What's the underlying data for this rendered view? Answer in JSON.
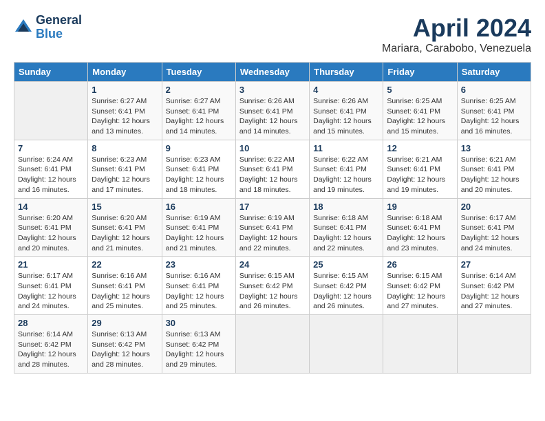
{
  "header": {
    "logo_line1": "General",
    "logo_line2": "Blue",
    "month": "April 2024",
    "location": "Mariara, Carabobo, Venezuela"
  },
  "days_of_week": [
    "Sunday",
    "Monday",
    "Tuesday",
    "Wednesday",
    "Thursday",
    "Friday",
    "Saturday"
  ],
  "weeks": [
    [
      {
        "day": "",
        "sunrise": "",
        "sunset": "",
        "daylight": ""
      },
      {
        "day": "1",
        "sunrise": "Sunrise: 6:27 AM",
        "sunset": "Sunset: 6:41 PM",
        "daylight": "Daylight: 12 hours and 13 minutes."
      },
      {
        "day": "2",
        "sunrise": "Sunrise: 6:27 AM",
        "sunset": "Sunset: 6:41 PM",
        "daylight": "Daylight: 12 hours and 14 minutes."
      },
      {
        "day": "3",
        "sunrise": "Sunrise: 6:26 AM",
        "sunset": "Sunset: 6:41 PM",
        "daylight": "Daylight: 12 hours and 14 minutes."
      },
      {
        "day": "4",
        "sunrise": "Sunrise: 6:26 AM",
        "sunset": "Sunset: 6:41 PM",
        "daylight": "Daylight: 12 hours and 15 minutes."
      },
      {
        "day": "5",
        "sunrise": "Sunrise: 6:25 AM",
        "sunset": "Sunset: 6:41 PM",
        "daylight": "Daylight: 12 hours and 15 minutes."
      },
      {
        "day": "6",
        "sunrise": "Sunrise: 6:25 AM",
        "sunset": "Sunset: 6:41 PM",
        "daylight": "Daylight: 12 hours and 16 minutes."
      }
    ],
    [
      {
        "day": "7",
        "sunrise": "Sunrise: 6:24 AM",
        "sunset": "Sunset: 6:41 PM",
        "daylight": "Daylight: 12 hours and 16 minutes."
      },
      {
        "day": "8",
        "sunrise": "Sunrise: 6:23 AM",
        "sunset": "Sunset: 6:41 PM",
        "daylight": "Daylight: 12 hours and 17 minutes."
      },
      {
        "day": "9",
        "sunrise": "Sunrise: 6:23 AM",
        "sunset": "Sunset: 6:41 PM",
        "daylight": "Daylight: 12 hours and 18 minutes."
      },
      {
        "day": "10",
        "sunrise": "Sunrise: 6:22 AM",
        "sunset": "Sunset: 6:41 PM",
        "daylight": "Daylight: 12 hours and 18 minutes."
      },
      {
        "day": "11",
        "sunrise": "Sunrise: 6:22 AM",
        "sunset": "Sunset: 6:41 PM",
        "daylight": "Daylight: 12 hours and 19 minutes."
      },
      {
        "day": "12",
        "sunrise": "Sunrise: 6:21 AM",
        "sunset": "Sunset: 6:41 PM",
        "daylight": "Daylight: 12 hours and 19 minutes."
      },
      {
        "day": "13",
        "sunrise": "Sunrise: 6:21 AM",
        "sunset": "Sunset: 6:41 PM",
        "daylight": "Daylight: 12 hours and 20 minutes."
      }
    ],
    [
      {
        "day": "14",
        "sunrise": "Sunrise: 6:20 AM",
        "sunset": "Sunset: 6:41 PM",
        "daylight": "Daylight: 12 hours and 20 minutes."
      },
      {
        "day": "15",
        "sunrise": "Sunrise: 6:20 AM",
        "sunset": "Sunset: 6:41 PM",
        "daylight": "Daylight: 12 hours and 21 minutes."
      },
      {
        "day": "16",
        "sunrise": "Sunrise: 6:19 AM",
        "sunset": "Sunset: 6:41 PM",
        "daylight": "Daylight: 12 hours and 21 minutes."
      },
      {
        "day": "17",
        "sunrise": "Sunrise: 6:19 AM",
        "sunset": "Sunset: 6:41 PM",
        "daylight": "Daylight: 12 hours and 22 minutes."
      },
      {
        "day": "18",
        "sunrise": "Sunrise: 6:18 AM",
        "sunset": "Sunset: 6:41 PM",
        "daylight": "Daylight: 12 hours and 22 minutes."
      },
      {
        "day": "19",
        "sunrise": "Sunrise: 6:18 AM",
        "sunset": "Sunset: 6:41 PM",
        "daylight": "Daylight: 12 hours and 23 minutes."
      },
      {
        "day": "20",
        "sunrise": "Sunrise: 6:17 AM",
        "sunset": "Sunset: 6:41 PM",
        "daylight": "Daylight: 12 hours and 24 minutes."
      }
    ],
    [
      {
        "day": "21",
        "sunrise": "Sunrise: 6:17 AM",
        "sunset": "Sunset: 6:41 PM",
        "daylight": "Daylight: 12 hours and 24 minutes."
      },
      {
        "day": "22",
        "sunrise": "Sunrise: 6:16 AM",
        "sunset": "Sunset: 6:41 PM",
        "daylight": "Daylight: 12 hours and 25 minutes."
      },
      {
        "day": "23",
        "sunrise": "Sunrise: 6:16 AM",
        "sunset": "Sunset: 6:41 PM",
        "daylight": "Daylight: 12 hours and 25 minutes."
      },
      {
        "day": "24",
        "sunrise": "Sunrise: 6:15 AM",
        "sunset": "Sunset: 6:42 PM",
        "daylight": "Daylight: 12 hours and 26 minutes."
      },
      {
        "day": "25",
        "sunrise": "Sunrise: 6:15 AM",
        "sunset": "Sunset: 6:42 PM",
        "daylight": "Daylight: 12 hours and 26 minutes."
      },
      {
        "day": "26",
        "sunrise": "Sunrise: 6:15 AM",
        "sunset": "Sunset: 6:42 PM",
        "daylight": "Daylight: 12 hours and 27 minutes."
      },
      {
        "day": "27",
        "sunrise": "Sunrise: 6:14 AM",
        "sunset": "Sunset: 6:42 PM",
        "daylight": "Daylight: 12 hours and 27 minutes."
      }
    ],
    [
      {
        "day": "28",
        "sunrise": "Sunrise: 6:14 AM",
        "sunset": "Sunset: 6:42 PM",
        "daylight": "Daylight: 12 hours and 28 minutes."
      },
      {
        "day": "29",
        "sunrise": "Sunrise: 6:13 AM",
        "sunset": "Sunset: 6:42 PM",
        "daylight": "Daylight: 12 hours and 28 minutes."
      },
      {
        "day": "30",
        "sunrise": "Sunrise: 6:13 AM",
        "sunset": "Sunset: 6:42 PM",
        "daylight": "Daylight: 12 hours and 29 minutes."
      },
      {
        "day": "",
        "sunrise": "",
        "sunset": "",
        "daylight": ""
      },
      {
        "day": "",
        "sunrise": "",
        "sunset": "",
        "daylight": ""
      },
      {
        "day": "",
        "sunrise": "",
        "sunset": "",
        "daylight": ""
      },
      {
        "day": "",
        "sunrise": "",
        "sunset": "",
        "daylight": ""
      }
    ]
  ]
}
